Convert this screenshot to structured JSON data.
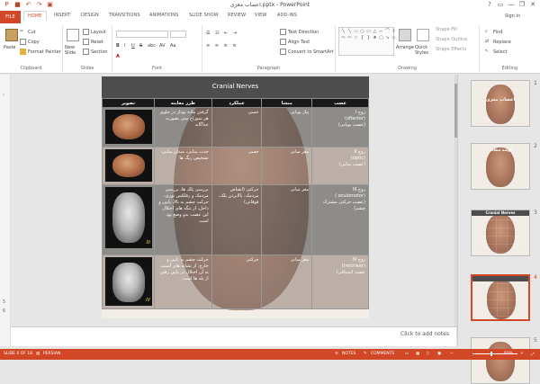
{
  "window": {
    "title": "اعصاب مغزی.pptx - PowerPoint",
    "qat": [
      "save-icon",
      "undo-icon",
      "redo-icon",
      "present-icon"
    ],
    "controls": [
      "?",
      "▭",
      "—",
      "❐",
      "✕"
    ]
  },
  "tabs": [
    "FILE",
    "HOME",
    "INSERT",
    "DESIGN",
    "TRANSITIONS",
    "ANIMATIONS",
    "SLIDE SHOW",
    "REVIEW",
    "VIEW",
    "ADD-INS"
  ],
  "signin": "Sign in",
  "ribbon": {
    "clipboard": {
      "label": "Clipboard",
      "paste": "Paste",
      "cut": "Cut",
      "copy": "Copy",
      "format_painter": "Format Painter"
    },
    "slides": {
      "label": "Slides",
      "new_slide": "New Slide",
      "layout": "Layout",
      "reset": "Reset",
      "section": "Section"
    },
    "font": {
      "label": "Font",
      "bold": "B",
      "italic": "I",
      "underline": "U",
      "strike": "S",
      "shadow": "abc",
      "spacing": "AV",
      "case": "Aa"
    },
    "paragraph": {
      "label": "Paragraph",
      "text_direction": "Text Direction",
      "align_text": "Align Text",
      "smartart": "Convert to SmartArt"
    },
    "drawing": {
      "label": "Drawing",
      "arrange": "Arrange",
      "quick_styles": "Quick Styles",
      "shape_fill": "Shape Fill",
      "shape_outline": "Shape Outline",
      "shape_effects": "Shape Effects"
    },
    "editing": {
      "label": "Editing",
      "find": "Find",
      "replace": "Replace",
      "select": "Select"
    }
  },
  "slide": {
    "title": "Cranial Nerves",
    "headers": [
      "تصویر",
      "طرز معاینه",
      "عملکرد",
      "منشا",
      "عصب"
    ],
    "rows": [
      {
        "image_tag": "",
        "exam": "گرفتن ماده بودار در جلوی هر سوراخ بینی بصورت جداگانه",
        "function": "حسی",
        "origin": "پیاز بویایی",
        "nerve_a": "زوج I",
        "nerve_b": "(olfactor)",
        "nerve_c": "(عصب بویایی)"
      },
      {
        "image_tag": "",
        "exam": "حدت بینایی، میدان بینایی، تشخیص رنگ ها",
        "function": "حسی",
        "origin": "مغز میانی",
        "nerve_a": "زوج II",
        "nerve_b": "(optic)",
        "nerve_c": "(عصب بینایی)"
      },
      {
        "image_tag": "III",
        "exam": "بررسی پلک ها، بررسی مردمک و رفلکس نوری، حرکت چشم به بالا، پایین و داخل، از تنگه های اختلال این عصب بدو وضع بود است",
        "function": "حرکتی (انقباض مردمک، بالابردن پلک، فوقانی)",
        "origin": "مغز میانی",
        "nerve_a": "زوج III",
        "nerve_b": "( oculomotor)",
        "nerve_c": "(عصب حرکتی مشترک چشم)"
      },
      {
        "image_tag": "IV",
        "exam": "حرکت چشم به پایین و خارج. از نشانه های آسیب به آن اختلال در پایین رفتن از پله ها است",
        "function": "حرکتی",
        "origin": "مغز میانی",
        "nerve_a": "زوج IV",
        "nerve_b": "(trochlear)",
        "nerve_c": "عصب اشتیاقی)"
      }
    ]
  },
  "thumbnails": [
    {
      "num": "1",
      "title": "اعصاب مغزی"
    },
    {
      "num": "2",
      "title": "گوشه مطالب"
    },
    {
      "num": "3",
      "title": "Cranial Nerves"
    },
    {
      "num": "4",
      "title": ""
    },
    {
      "num": "5",
      "title": ""
    }
  ],
  "notes_placeholder": "Click to add notes",
  "status": {
    "slide": "SLIDE 4 OF 18",
    "language": "PERSIAN",
    "notes": "NOTES",
    "comments": "COMMENTS",
    "zoom": "60%"
  }
}
